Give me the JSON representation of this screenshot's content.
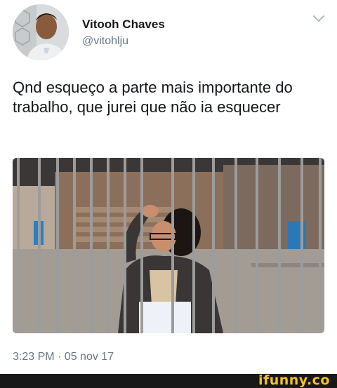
{
  "tweet": {
    "author": {
      "name": "Vitooh Chaves",
      "handle": "@vitohlju"
    },
    "text": "Qnd esqueço a parte mais importante do trabalho, que jurei que não ia esquecer",
    "timestamp": "3:23 PM · 05 nov 17",
    "menu_icon": "chevron-down-icon",
    "photo_description_icon": "photo"
  },
  "watermark": {
    "text": "ifunny.co",
    "color": "#f7c21a"
  }
}
